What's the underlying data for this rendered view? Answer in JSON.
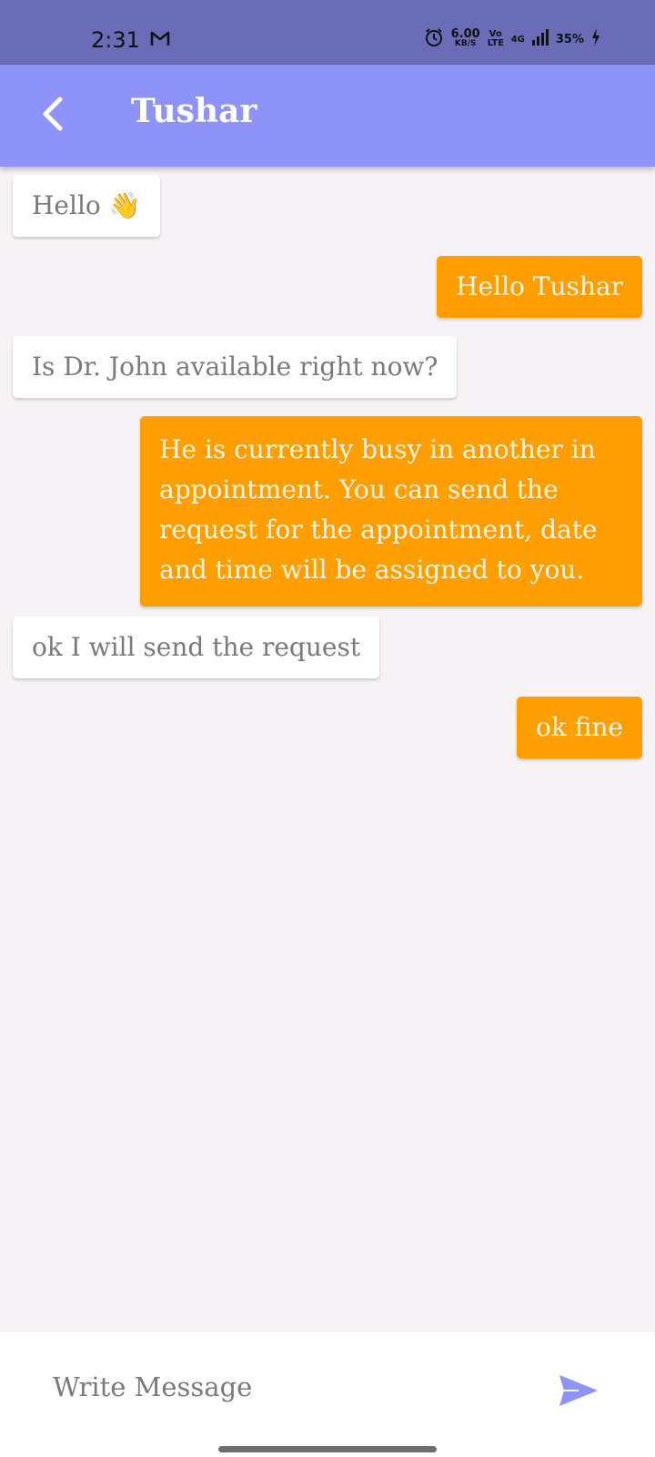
{
  "status_bar": {
    "time": "2:31",
    "speed_value": "6.00",
    "speed_unit": "KB/S",
    "volte": "Vo LTE",
    "network": "4G",
    "battery": "35%"
  },
  "header": {
    "title": "Tushar"
  },
  "messages": [
    {
      "side": "incoming",
      "text": "Hello 👋"
    },
    {
      "side": "outgoing",
      "text": "Hello Tushar"
    },
    {
      "side": "incoming",
      "text": "Is Dr. John available right now?"
    },
    {
      "side": "outgoing",
      "text": "He is currently busy in another in appointment. You can send the request for the appointment, date and time will be assigned to you."
    },
    {
      "side": "incoming",
      "text": "ok I will send the request"
    },
    {
      "side": "outgoing",
      "text": "ok fine"
    }
  ],
  "composer": {
    "placeholder": "Write Message",
    "value": ""
  },
  "colors": {
    "status_bar": "#6a6cb8",
    "app_bar": "#8e93f7",
    "outgoing_bubble": "#ff9e00",
    "incoming_bubble": "#ffffff",
    "send_icon": "#8e93f7"
  }
}
